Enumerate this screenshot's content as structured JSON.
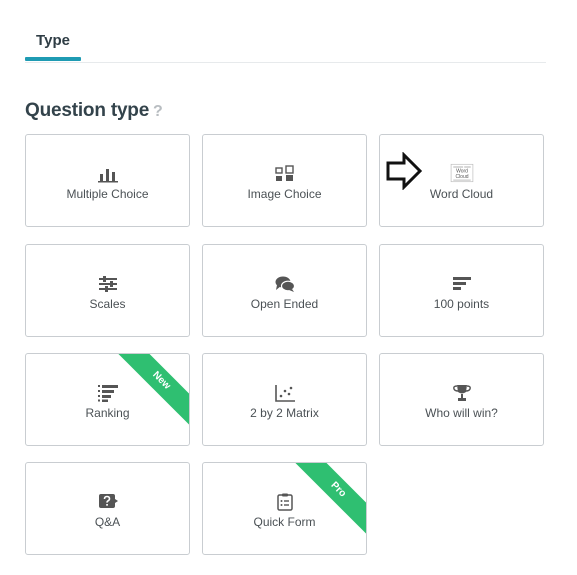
{
  "tabs": {
    "active": "Type"
  },
  "section": {
    "title": "Question type",
    "help": "?"
  },
  "cards": {
    "multiple_choice": {
      "label": "Multiple Choice",
      "icon": "bar-chart-icon"
    },
    "image_choice": {
      "label": "Image Choice",
      "icon": "image-choice-icon"
    },
    "word_cloud": {
      "label": "Word Cloud",
      "icon": "word-cloud-icon",
      "icon_text": [
        "Word",
        "Cloud"
      ]
    },
    "scales": {
      "label": "Scales",
      "icon": "sliders-icon"
    },
    "open_ended": {
      "label": "Open Ended",
      "icon": "speech-bubbles-icon"
    },
    "points_100": {
      "label": "100 points",
      "icon": "horizontal-bars-icon"
    },
    "ranking": {
      "label": "Ranking",
      "icon": "ranking-icon",
      "badge": "New"
    },
    "matrix_2x2": {
      "label": "2 by 2 Matrix",
      "icon": "scatter-plot-icon"
    },
    "who_will_win": {
      "label": "Who will win?",
      "icon": "trophy-icon"
    },
    "qa": {
      "label": "Q&A",
      "icon": "question-bubble-icon"
    },
    "quick_form": {
      "label": "Quick Form",
      "icon": "clipboard-icon",
      "badge": "Pro"
    }
  },
  "colors": {
    "accent": "#1f9bb3",
    "badge": "#2fbf71",
    "border": "#c9cdd1"
  }
}
